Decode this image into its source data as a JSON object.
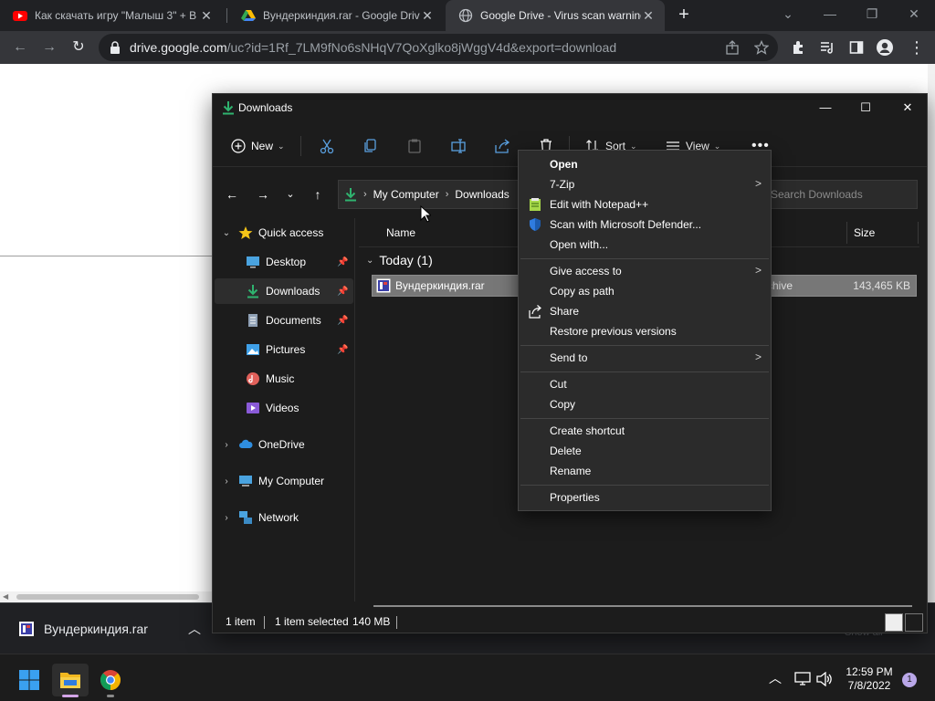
{
  "browser": {
    "tabs": [
      {
        "title": "Как скачать игру \"Малыш 3\" + В",
        "favicon": "youtube-icon"
      },
      {
        "title": "Вундеркиндия.rar - Google Drive",
        "favicon": "google-drive-icon"
      },
      {
        "title": "Google Drive - Virus scan warning",
        "favicon": "globe-icon"
      }
    ],
    "new_tab_label": "+",
    "url_host": "drive.google.com",
    "url_rest": "/uc?id=1Rf_7LM9fNo6sNHqV7QoXglko8jWggV4d&export=download"
  },
  "download_bar": {
    "file_name": "Вундеркиндия.rar",
    "show_all": "Show all"
  },
  "explorer": {
    "title": "Downloads",
    "commands": {
      "new": "New",
      "sort": "Sort",
      "view": "View"
    },
    "breadcrumb": [
      "My Computer",
      "Downloads"
    ],
    "search_placeholder": "Search Downloads",
    "nav": {
      "quick_access": "Quick access",
      "desktop": "Desktop",
      "downloads": "Downloads",
      "documents": "Documents",
      "pictures": "Pictures",
      "music": "Music",
      "videos": "Videos",
      "onedrive": "OneDrive",
      "my_computer": "My Computer",
      "network": "Network"
    },
    "columns": {
      "name": "Name",
      "size": "Size"
    },
    "group": "Today (1)",
    "file": {
      "name": "Вундеркиндия.rar",
      "type": "chive",
      "size": "143,465 KB"
    },
    "status": {
      "count": "1 item",
      "selected": "1 item selected",
      "size": "140 MB"
    }
  },
  "context_menu": {
    "items": [
      {
        "label": "Open",
        "bold": true
      },
      {
        "label": "7-Zip",
        "submenu": true
      },
      {
        "label": "Edit with Notepad++",
        "icon": "notepad-plus-plus-icon"
      },
      {
        "label": "Scan with Microsoft Defender...",
        "icon": "defender-shield-icon"
      },
      {
        "label": "Open with..."
      },
      {
        "label": "Give access to",
        "submenu": true
      },
      {
        "label": "Copy as path"
      },
      {
        "label": "Share",
        "icon": "share-icon"
      },
      {
        "label": "Restore previous versions"
      },
      {
        "label": "Send to",
        "submenu": true
      },
      {
        "label": "Cut"
      },
      {
        "label": "Copy"
      },
      {
        "label": "Create shortcut"
      },
      {
        "label": "Delete"
      },
      {
        "label": "Rename"
      },
      {
        "label": "Properties"
      }
    ],
    "submenu_glyph": ">"
  },
  "taskbar": {
    "time": "12:59 PM",
    "date": "7/8/2022",
    "notification_count": "1"
  },
  "colors": {
    "chrome_dark": "#202124",
    "chrome_toolbar": "#35363a",
    "explorer_bg": "#1c1c1c",
    "menu_bg": "#2b2b2b",
    "selection_gray": "#777777",
    "accent_green": "#2fb36f"
  }
}
